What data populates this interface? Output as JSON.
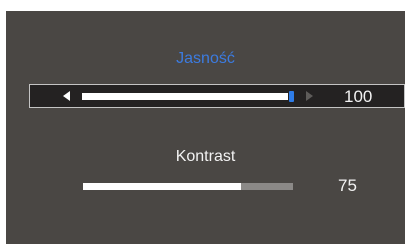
{
  "osd": {
    "colors": {
      "panel_background": "#4a4744",
      "selected_row_background": "#242222",
      "selected_title": "#3c7be0",
      "slider_knob": "#2e7ce8",
      "slider_fill": "#ffffff",
      "slider_track": "#8b8987"
    },
    "brightness": {
      "label": "Jasność",
      "value": "100",
      "level_percent": 100,
      "selected": true,
      "left_icon": "arrow-left-icon",
      "right_icon": "arrow-right-icon"
    },
    "contrast": {
      "label": "Kontrast",
      "value": "75",
      "level_percent": 75,
      "selected": false
    }
  }
}
